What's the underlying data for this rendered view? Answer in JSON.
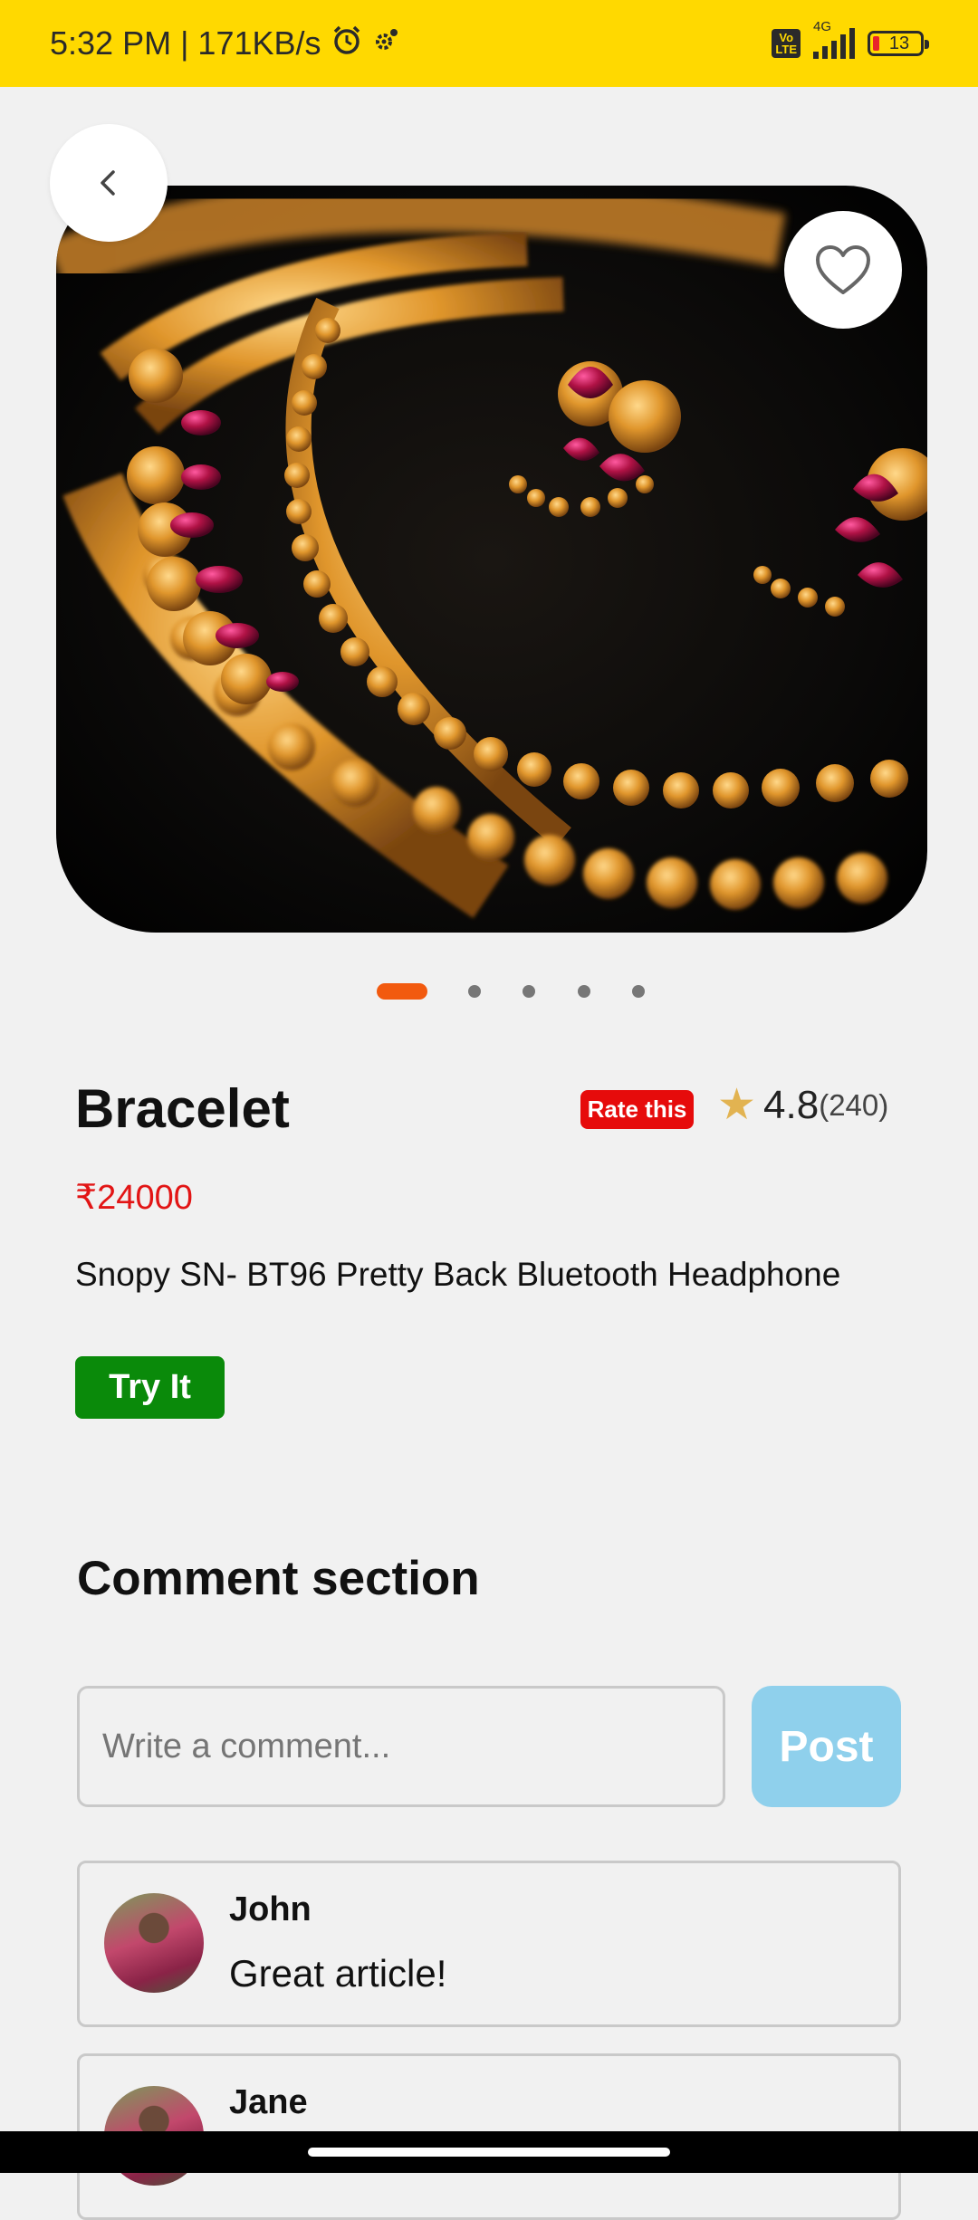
{
  "status_bar": {
    "time_speed": "5:32 PM | 171KB/s",
    "volte": "Vo LTE",
    "network": "4G",
    "battery": "13"
  },
  "product": {
    "title": "Bracelet",
    "rate_label": "Rate this",
    "rating": "4.8",
    "rating_count": "(240)",
    "price": "₹24000",
    "description": "Snopy SN- BT96 Pretty Back Bluetooth Headphone",
    "try_label": "Try It"
  },
  "carousel": {
    "total": 5,
    "active": 1
  },
  "comments_section": {
    "heading": "Comment section",
    "input_placeholder": "Write a comment...",
    "post_label": "Post",
    "comments": [
      {
        "name": "John",
        "text": "Great article!"
      },
      {
        "name": "Jane",
        "text": ""
      }
    ]
  },
  "colors": {
    "status_bar": "#ffd900",
    "accent_dot": "#f25a0f",
    "price": "#e21515",
    "rate_badge": "#e60b0b",
    "try_button": "#0a8a0a",
    "post_button": "#8fd0ec",
    "star": "#e2b351"
  }
}
